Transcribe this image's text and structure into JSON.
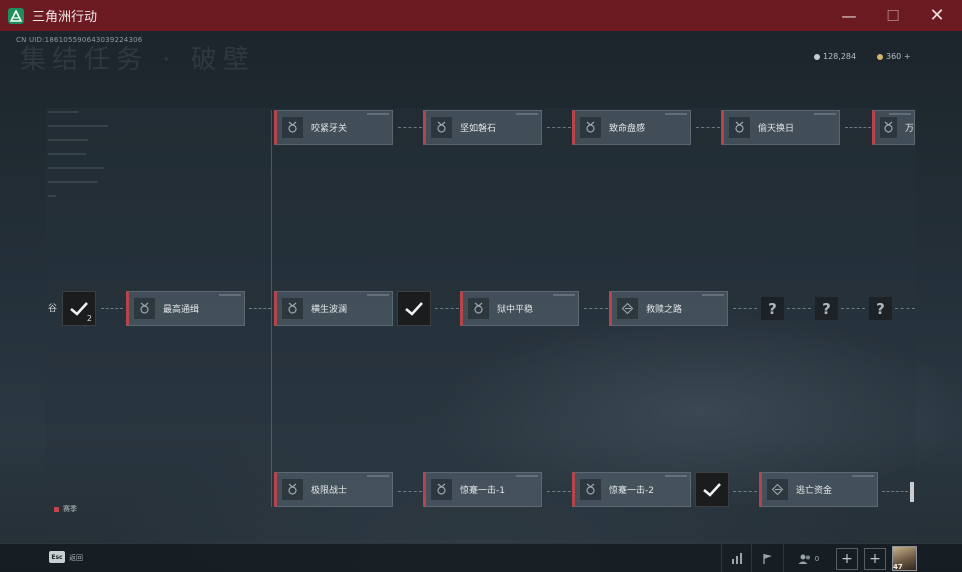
{
  "window": {
    "title": "三角洲行动",
    "minimize_glyph": "—",
    "maximize_glyph": "☐",
    "close_glyph": "✕"
  },
  "header": {
    "uid": "CN UID:186105590643039224306",
    "bg_title": "集结任务 · 破壁",
    "currency": [
      {
        "value": "128,284",
        "icon": "silver-coin-icon",
        "color": "#c8cfd4"
      },
      {
        "value": "360 +",
        "icon": "gold-coin-icon",
        "color": "#d7b36a"
      }
    ]
  },
  "missions": {
    "edge_label": "谷",
    "top_row": [
      "咬紧牙关",
      "坚如磐石",
      "致命盘感",
      "偷天换日",
      "万"
    ],
    "middle_row": [
      "最高通缉",
      "横生波澜",
      "狱中平稳",
      "救赎之路"
    ],
    "bottom_row": [
      "极限战士",
      "惊蹇一击-1",
      "惊蹇一击-2",
      "逃亡资金"
    ],
    "completed_count": "2",
    "locked_glyph": "?"
  },
  "legend": {
    "label": "赛季",
    "color": "#c0454c"
  },
  "bottombar": {
    "esc_key": "Esc",
    "esc_label": "返回",
    "squad_count": "0",
    "plus_glyph": "+",
    "level": "47"
  }
}
